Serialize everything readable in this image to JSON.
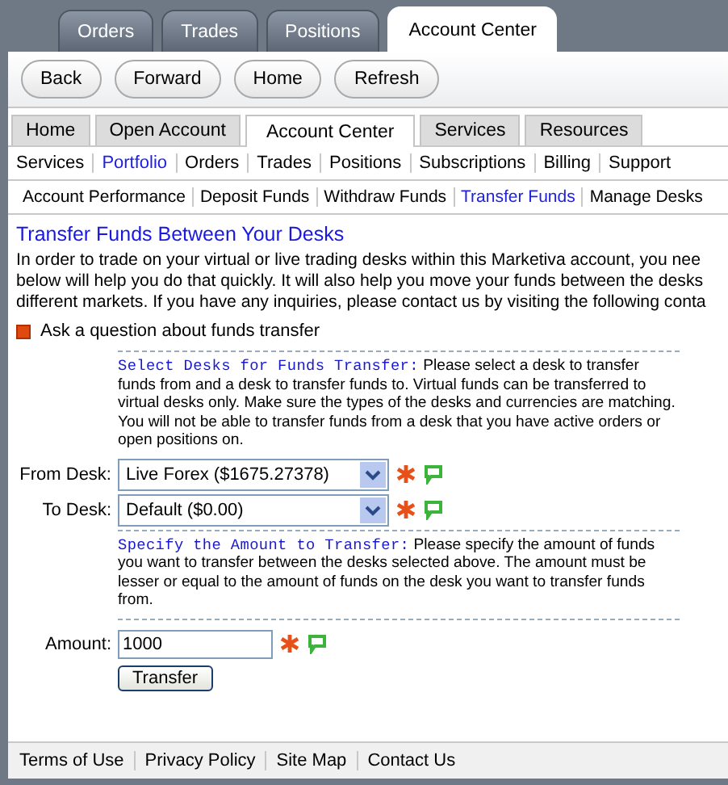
{
  "top_tabs": [
    {
      "label": "Orders",
      "selected": false
    },
    {
      "label": "Trades",
      "selected": false
    },
    {
      "label": "Positions",
      "selected": false
    },
    {
      "label": "Account Center",
      "selected": true
    }
  ],
  "nav_buttons": [
    "Back",
    "Forward",
    "Home",
    "Refresh"
  ],
  "main_tabs": [
    {
      "label": "Home",
      "selected": false
    },
    {
      "label": "Open Account",
      "selected": false
    },
    {
      "label": "Account Center",
      "selected": true
    },
    {
      "label": "Services",
      "selected": false
    },
    {
      "label": "Resources",
      "selected": false
    }
  ],
  "sub_menu": [
    {
      "label": "Services",
      "selected": false
    },
    {
      "label": "Portfolio",
      "selected": true
    },
    {
      "label": "Orders",
      "selected": false
    },
    {
      "label": "Trades",
      "selected": false
    },
    {
      "label": "Positions",
      "selected": false
    },
    {
      "label": "Subscriptions",
      "selected": false
    },
    {
      "label": "Billing",
      "selected": false
    },
    {
      "label": "Support",
      "selected": false
    }
  ],
  "sub_sub_menu": [
    {
      "label": "Account Performance",
      "selected": false
    },
    {
      "label": "Deposit Funds",
      "selected": false
    },
    {
      "label": "Withdraw Funds",
      "selected": false
    },
    {
      "label": "Transfer Funds",
      "selected": true
    },
    {
      "label": "Manage Desks",
      "selected": false
    }
  ],
  "page": {
    "title": "Transfer Funds Between Your Desks",
    "intro_lines": [
      "In order to trade on your virtual or live trading desks within this Marketiva account, you nee",
      "below will help you do that quickly. It will also help you move your funds between the desks",
      "different markets. If you have any inquiries, please contact us by visiting the following conta"
    ],
    "ask_link": "Ask a question about funds transfer",
    "desk_section": {
      "heading": "Select Desks for Funds Transfer:",
      "text": "Please select a desk to transfer funds from and a desk to transfer funds to. Virtual funds can be transferred to virtual desks only. Make sure the types of the desks and currencies are matching. You will not be able to transfer funds from a desk that you have active orders or open positions on."
    },
    "from_desk": {
      "label": "From Desk:",
      "value": "Live Forex ($1675.27378)"
    },
    "to_desk": {
      "label": "To Desk:",
      "value": "Default ($0.00)"
    },
    "amount_section": {
      "heading": "Specify the Amount to Transfer:",
      "text": "Please specify the amount of funds you want to transfer between the desks selected above. The amount must be lesser or equal to the amount of funds on the desk you want to transfer funds from."
    },
    "amount": {
      "label": "Amount:",
      "value": "1000"
    },
    "submit": "Transfer"
  },
  "footer": [
    "Terms of Use",
    "Privacy Policy",
    "Site Map",
    "Contact Us"
  ]
}
